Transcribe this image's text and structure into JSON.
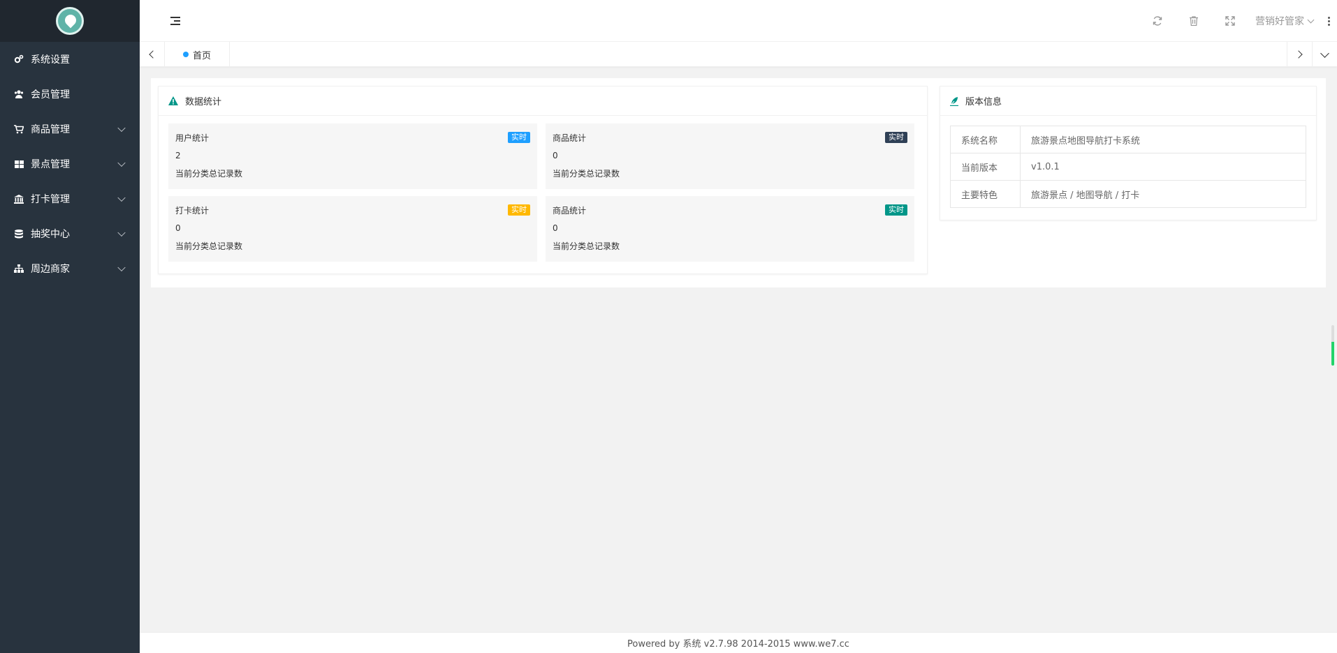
{
  "sidebar": {
    "items": [
      {
        "label": "系统设置",
        "icon": "gears-icon",
        "has_children": false
      },
      {
        "label": "会员管理",
        "icon": "users-icon",
        "has_children": false
      },
      {
        "label": "商品管理",
        "icon": "cart-icon",
        "has_children": true
      },
      {
        "label": "景点管理",
        "icon": "grid-icon",
        "has_children": true
      },
      {
        "label": "打卡管理",
        "icon": "bank-icon",
        "has_children": true
      },
      {
        "label": "抽奖中心",
        "icon": "database-icon",
        "has_children": true
      },
      {
        "label": "周边商家",
        "icon": "sitemap-icon",
        "has_children": true
      }
    ]
  },
  "header": {
    "user_name": "营销好管家",
    "icons": [
      "refresh-icon",
      "trash-icon",
      "fullscreen-icon",
      "more-icon"
    ]
  },
  "tabs": [
    {
      "label": "首页",
      "active": true
    }
  ],
  "stats_card": {
    "title": "数据统计",
    "boxes": [
      {
        "title": "用户统计",
        "badge": "实时",
        "badge_color": "#1e9fff",
        "value": "2",
        "desc": "当前分类总记录数"
      },
      {
        "title": "商品统计",
        "badge": "实时",
        "badge_color": "#2f4056",
        "value": "0",
        "desc": "当前分类总记录数"
      },
      {
        "title": "打卡统计",
        "badge": "实时",
        "badge_color": "#ffb800",
        "value": "0",
        "desc": "当前分类总记录数"
      },
      {
        "title": "商品统计",
        "badge": "实时",
        "badge_color": "#009688",
        "value": "0",
        "desc": "当前分类总记录数"
      }
    ]
  },
  "version_card": {
    "title": "版本信息",
    "rows": [
      {
        "key": "系统名称",
        "value": "旅游景点地图导航打卡系统"
      },
      {
        "key": "当前版本",
        "value": "v1.0.1"
      },
      {
        "key": "主要特色",
        "value": "旅游景点 / 地图导航 / 打卡"
      }
    ]
  },
  "footer": {
    "text": "Powered by 系统 v2.7.98 2014-2015 www.we7.cc"
  },
  "colors": {
    "sidebar_bg": "#28333e",
    "accent_teal": "#009688",
    "accent_blue": "#1e9fff"
  }
}
